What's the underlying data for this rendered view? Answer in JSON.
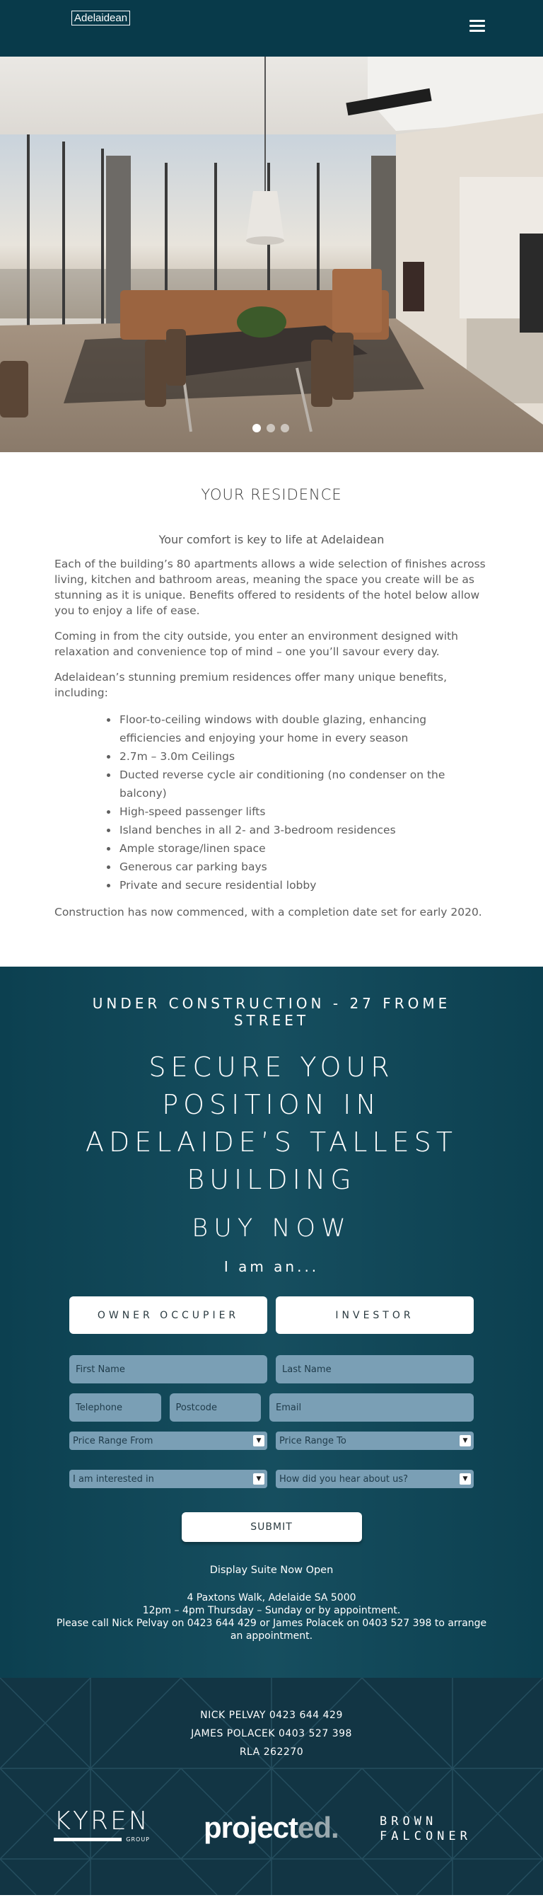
{
  "header": {
    "logo_text": "Adelaidean",
    "menu_icon": "hamburger-menu-icon"
  },
  "hero": {
    "carousel": {
      "slide_count": 3,
      "active_index": 0
    }
  },
  "residence": {
    "title": "YOUR RESIDENCE",
    "subtitle": "Your comfort is key to life at Adelaidean",
    "paragraphs": [
      "Each of the building’s 80 apartments allows a wide selection of finishes across living, kitchen and bathroom areas, meaning the space you create will be as stunning as it is unique. Benefits offered to residents of the hotel below allow you to enjoy a life of ease.",
      "Coming in from the city outside, you enter an environment designed with relaxation and convenience top of mind – one you’ll savour every day.",
      "Adelaidean’s stunning premium residences offer many unique benefits, including:"
    ],
    "benefits": [
      "Floor-to-ceiling windows with double glazing, enhancing efficiencies and enjoying your home in every season",
      "2.7m – 3.0m Ceilings",
      "Ducted reverse cycle air conditioning (no condenser on the balcony)",
      "High-speed passenger lifts",
      "Island benches in all 2- and 3-bedroom residences",
      "Ample storage/linen space",
      "Generous car parking bays",
      "Private and secure residential lobby"
    ],
    "closing": "Construction has now commenced, with a completion date set for early 2020."
  },
  "cta": {
    "kicker": "UNDER CONSTRUCTION -  27 FROME STREET",
    "headline": "SECURE YOUR POSITION IN ADELAIDE’S TALLEST BUILDING",
    "buy_now": "BUY NOW",
    "i_am": "I am an...",
    "buyer_types": [
      "OWNER OCCUPIER",
      "INVESTOR"
    ]
  },
  "form": {
    "first_name_placeholder": "First Name",
    "last_name_placeholder": "Last Name",
    "telephone_placeholder": "Telephone",
    "postcode_placeholder": "Postcode",
    "email_placeholder": "Email",
    "price_from": "Price Range From",
    "price_to": "Price Range To",
    "interested_in": "I am interested in",
    "heard_about": "How did you hear about us?",
    "submit_label": "SUBMIT"
  },
  "display_suite": {
    "title": "Display Suite Now Open",
    "address": "4 Paxtons Walk, Adelaide SA 5000",
    "hours": "12pm – 4pm Thursday – Sunday or by appointment.",
    "call": "Please call Nick Pelvay on 0423 644 429 or James Polacek on 0403 527 398 to arrange an appointment."
  },
  "footer": {
    "contacts": [
      "NICK PELVAY   0423 644 429",
      "JAMES POLACEK   0403 527 398",
      "RLA 262270"
    ],
    "brands": {
      "kyren_name": "KYREN",
      "kyren_sub": "GROUP",
      "projected_main": "project",
      "projected_suffix": "ed.",
      "brown_line1": "BROWN",
      "brown_line2": "FALCONER"
    }
  },
  "colors": {
    "header_bg": "#083a4a",
    "cta_bg": "#164e5f",
    "field_bg": "#7a9fb5",
    "footer_bg": "#123544"
  }
}
